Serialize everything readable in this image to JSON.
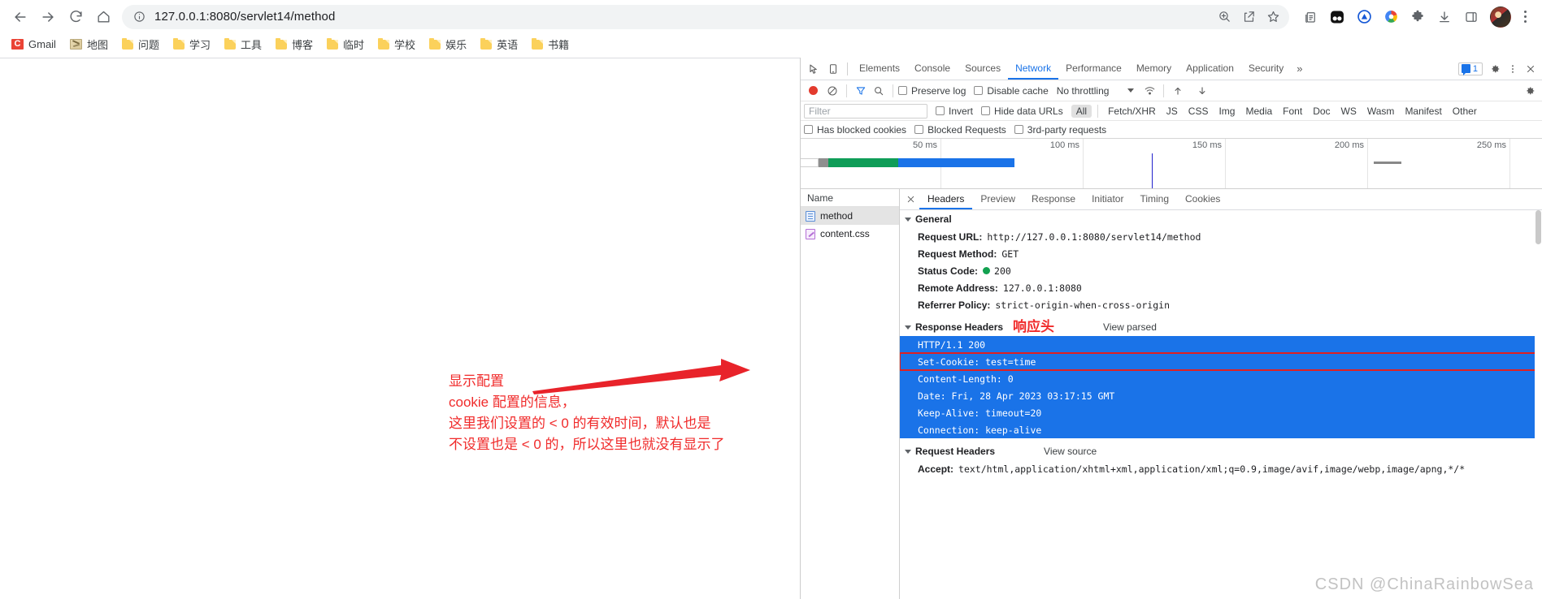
{
  "browser": {
    "nav": {
      "back": "back-arrow",
      "forward": "forward-arrow",
      "reload": "reload",
      "home": "home"
    },
    "omnibox": {
      "info_icon": "site-information-icon",
      "url_host": "127.0.0.1:8080",
      "url_path": "/servlet14/method",
      "url_full": "127.0.0.1:8080/servlet14/method",
      "zoom_icon": "zoom-in-icon",
      "share_icon": "share-icon",
      "bookmark_icon": "star-icon"
    },
    "toolbar_icons": [
      "reading-list-icon",
      "dark-reader-extension-icon",
      "grammarly-extension-icon",
      "color-wheel-extension-icon",
      "extensions-puzzle-icon",
      "downloads-icon",
      "side-panel-icon"
    ],
    "profile": "avatar",
    "menu": "chrome-menu-kebab",
    "bookmarks": [
      {
        "label": "Gmail",
        "icon": "gmail-icon"
      },
      {
        "label": "地图",
        "icon": "map-icon"
      },
      {
        "label": "问题",
        "icon": "folder-icon"
      },
      {
        "label": "学习",
        "icon": "folder-icon"
      },
      {
        "label": "工具",
        "icon": "folder-icon"
      },
      {
        "label": "博客",
        "icon": "folder-icon"
      },
      {
        "label": "临时",
        "icon": "folder-icon"
      },
      {
        "label": "学校",
        "icon": "folder-icon"
      },
      {
        "label": "娱乐",
        "icon": "folder-icon"
      },
      {
        "label": "英语",
        "icon": "folder-icon"
      },
      {
        "label": "书籍",
        "icon": "folder-icon"
      }
    ]
  },
  "devtools": {
    "panel_tabs": [
      "Elements",
      "Console",
      "Sources",
      "Network",
      "Performance",
      "Memory",
      "Application",
      "Security"
    ],
    "active_panel": "Network",
    "overflow_label": "»",
    "message_count": "1",
    "settings_icon": "gear-icon",
    "kebab_icon": "more-options-icon",
    "close_icon": "close-icon",
    "inspect_icon": "inspect-element-icon",
    "device_icon": "device-toolbar-icon",
    "network_toolbar": {
      "record_icon": "record-button",
      "clear_icon": "clear-icon",
      "filter_icon": "filter-icon",
      "search_icon": "search-icon",
      "preserve_log": "Preserve log",
      "disable_cache": "Disable cache",
      "throttling": "No throttling",
      "wifi_icon": "network-conditions-icon",
      "import_icon": "import-har-icon",
      "export_icon": "export-har-icon",
      "settings_icon": "network-settings-gear-icon"
    },
    "filter_bar": {
      "placeholder": "Filter",
      "invert": "Invert",
      "hide_data_urls": "Hide data URLs",
      "types": [
        "All",
        "Fetch/XHR",
        "JS",
        "CSS",
        "Img",
        "Media",
        "Font",
        "Doc",
        "WS",
        "Wasm",
        "Manifest",
        "Other"
      ],
      "active_type": "All",
      "has_blocked_cookies": "Has blocked cookies",
      "blocked_requests": "Blocked Requests",
      "third_party_requests": "3rd-party requests"
    },
    "overview": {
      "ticks": [
        "50 ms",
        "100 ms",
        "150 ms",
        "200 ms",
        "250 ms"
      ],
      "bars": [
        {
          "color": "#ffffff",
          "start_pct": 0.0,
          "width_pct": 3.2
        },
        {
          "color": "#8f8f8f",
          "start_pct": 3.2,
          "width_pct": 1.4
        },
        {
          "color": "#0f9d58",
          "start_pct": 4.6,
          "width_pct": 9.5
        },
        {
          "color": "#1a73e8",
          "start_pct": 14.1,
          "width_pct": 14.5
        }
      ],
      "needle_pct": 48.5,
      "dash_pct": 78.5
    },
    "requests": {
      "column_header": "Name",
      "rows": [
        {
          "name": "method",
          "icon": "document-icon",
          "selected": true
        },
        {
          "name": "content.css",
          "icon": "stylesheet-icon",
          "selected": false
        }
      ]
    },
    "detail_tabs": [
      "Headers",
      "Preview",
      "Response",
      "Initiator",
      "Timing",
      "Cookies"
    ],
    "active_detail_tab": "Headers",
    "general": {
      "title": "General",
      "rows": [
        {
          "key": "Request URL:",
          "value": "http://127.0.0.1:8080/servlet14/method"
        },
        {
          "key": "Request Method:",
          "value": "GET"
        },
        {
          "key": "Status Code:",
          "value": "200",
          "status_dot": "#12a150"
        },
        {
          "key": "Remote Address:",
          "value": "127.0.0.1:8080"
        },
        {
          "key": "Referrer Policy:",
          "value": "strict-origin-when-cross-origin"
        }
      ]
    },
    "response_headers": {
      "title": "Response Headers",
      "annotation": "响应头",
      "view_link": "View parsed",
      "rows": [
        {
          "text": "HTTP/1.1 200",
          "highlight": false
        },
        {
          "text": "Set-Cookie: test=time",
          "highlight": true
        },
        {
          "text": "Content-Length: 0",
          "highlight": false
        },
        {
          "text": "Date: Fri, 28 Apr 2023 03:17:15 GMT",
          "highlight": false
        },
        {
          "text": "Keep-Alive: timeout=20",
          "highlight": false
        },
        {
          "text": "Connection: keep-alive",
          "highlight": false
        }
      ]
    },
    "request_headers": {
      "title": "Request Headers",
      "view_link": "View source",
      "rows": [
        {
          "key": "Accept:",
          "value": "text/html,application/xhtml+xml,application/xml;q=0.9,image/avif,image/webp,image/apng,*/*"
        }
      ]
    }
  },
  "annotations": {
    "red_note_lines": [
      "显示配置",
      "cookie 配置的信息，",
      "这里我们设置的 < 0 的有效时间，默认也是",
      "不设置也是 < 0 的，所以这里也就没有显示了"
    ],
    "arrow": "red-arrow-pointing-right",
    "red_color": "#f02a2a"
  },
  "watermark": "CSDN @ChinaRainbowSea"
}
